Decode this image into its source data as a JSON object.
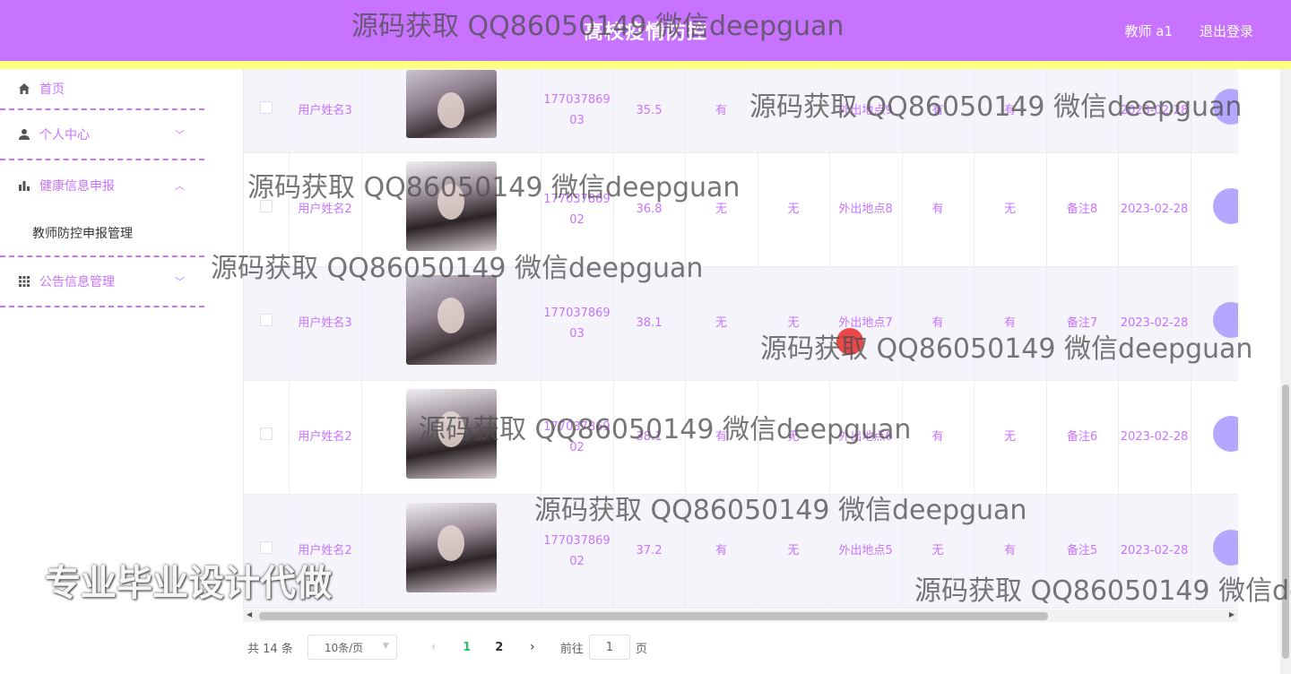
{
  "header": {
    "title": "高校疫情防控",
    "user": "教师 a1",
    "logout": "退出登录"
  },
  "sidebar": {
    "items": [
      {
        "label": "首页",
        "icon": "home-icon"
      },
      {
        "label": "个人中心",
        "icon": "person-icon"
      },
      {
        "label": "健康信息申报",
        "icon": "bar-chart-icon",
        "expanded": true
      },
      {
        "label": "公告信息管理",
        "icon": "grid-icon"
      }
    ],
    "submenu": "教师防控申报管理"
  },
  "table": {
    "rows": [
      {
        "name": "用户姓名3",
        "phone": "17703786903",
        "temp": "35.5",
        "c1": "有",
        "c2": "",
        "place": "外出地点9",
        "c3": "有",
        "c4": "有",
        "remark": "",
        "date": "2023-02-28"
      },
      {
        "name": "用户姓名2",
        "phone": "17703786902",
        "temp": "36.8",
        "c1": "无",
        "c2": "无",
        "place": "外出地点8",
        "c3": "有",
        "c4": "无",
        "remark": "备注8",
        "date": "2023-02-28"
      },
      {
        "name": "用户姓名3",
        "phone": "17703786903",
        "temp": "38.1",
        "c1": "无",
        "c2": "无",
        "place": "外出地点7",
        "c3": "有",
        "c4": "有",
        "remark": "备注7",
        "date": "2023-02-28"
      },
      {
        "name": "用户姓名2",
        "phone": "17703786902",
        "temp": "38.1",
        "c1": "有",
        "c2": "无",
        "place": "外出地点6",
        "c3": "有",
        "c4": "无",
        "remark": "备注6",
        "date": "2023-02-28"
      },
      {
        "name": "用户姓名2",
        "phone": "17703786902",
        "temp": "37.2",
        "c1": "有",
        "c2": "无",
        "place": "外出地点5",
        "c3": "无",
        "c4": "有",
        "remark": "备注5",
        "date": "2023-02-28"
      }
    ]
  },
  "pagination": {
    "total": "共 14 条",
    "page_size": "10条/页",
    "prev": "‹",
    "pages": [
      "1",
      "2"
    ],
    "next": "›",
    "goto_label": "前往",
    "goto_value": "1",
    "goto_suffix": "页"
  },
  "watermarks": {
    "text": "源码获取 QQ86050149 微信deepguan",
    "big": "专业毕业设计代做"
  }
}
